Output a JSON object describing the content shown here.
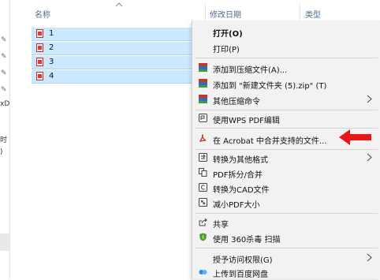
{
  "columns": {
    "name": "名称",
    "modified": "修改日期",
    "type": "类型"
  },
  "files": [
    {
      "name": "1"
    },
    {
      "name": "2"
    },
    {
      "name": "3"
    },
    {
      "name": "4"
    }
  ],
  "nav_fragments": [
    "xD",
    "时",
    ")"
  ],
  "context_menu": {
    "open": "打开(O)",
    "print": "打印(P)",
    "add_archive": "添加到压缩文件(A)...",
    "add_named_archive": "添加到 \"新建文件夹 (5).zip\" (T)",
    "other_compress": "其他压缩命令",
    "wps_pdf_edit": "使用WPS PDF编辑",
    "acrobat_merge": "在 Acrobat 中合并支持的文件...",
    "convert_other": "转换为其他格式",
    "pdf_split_merge": "PDF拆分/合并",
    "convert_cad": "转换为CAD文件",
    "reduce_pdf": "减小PDF大小",
    "share": "共享",
    "scan_360": "使用 360杀毒 扫描",
    "grant_access": "授予访问权限(G)",
    "upload_baidu": "上传到百度网盘"
  },
  "icons": {
    "sort": "chevron-up-icon",
    "pin": "pin-icon",
    "file": "pdf-file-icon",
    "archive": "winrar-archive-icon",
    "wps": "wps-pdf-icon",
    "acrobat": "acrobat-icon",
    "convert": "convert-format-icon",
    "split": "pdf-split-icon",
    "cad": "cad-icon",
    "reduce": "reduce-pdf-icon",
    "share": "share-icon",
    "shield": "360-shield-icon",
    "cloud": "baidu-netdisk-icon",
    "submenu": "chevron-right-icon",
    "annotation_arrow": "red-arrow-icon"
  },
  "colors": {
    "selection": "#cce8ff",
    "menu_bg": "#f2f2f2",
    "annotation": "#e8151b",
    "header_text": "#4d6d8e"
  }
}
